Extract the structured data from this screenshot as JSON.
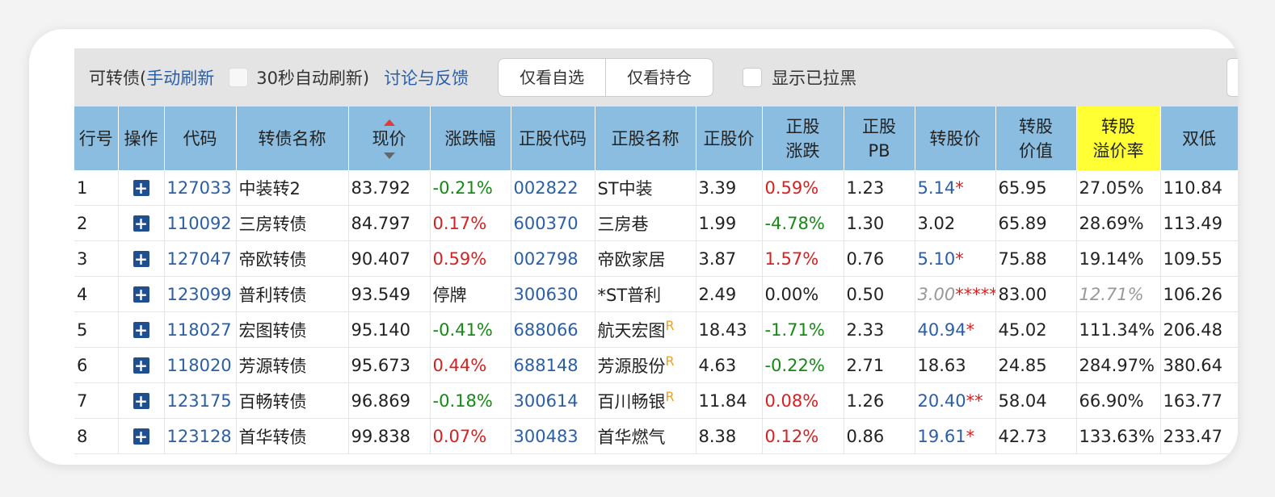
{
  "toolbar": {
    "prefix": "可转债(",
    "manual_refresh": "手动刷新",
    "auto_refresh": "30秒自动刷新)",
    "feedback": "讨论与反馈",
    "btn_watch": "仅看自选",
    "btn_hold": "仅看持仓",
    "show_blacklist": "显示已拉黑"
  },
  "columns": [
    "行号",
    "操作",
    "代码",
    "转债名称",
    "现价",
    "涨跌幅",
    "正股代码",
    "正股名称",
    "正股价",
    "正股涨跌",
    "正股PB",
    "转股价",
    "转股价值",
    "转股溢价率",
    "双低"
  ],
  "column_lines": {
    "stock_change": [
      "正股",
      "涨跌"
    ],
    "stock_pb": [
      "正股",
      "PB"
    ],
    "conv_value": [
      "转股",
      "价值"
    ],
    "premium": [
      "转股",
      "溢价率"
    ]
  },
  "rows": [
    {
      "no": "1",
      "code": "127033",
      "name": "中装转2",
      "price": "83.792",
      "chg": "-0.21%",
      "chg_dir": "down",
      "scode": "002822",
      "sname": "ST中装",
      "sR": "",
      "sprice": "3.39",
      "schg": "0.59%",
      "schg_dir": "up",
      "pb": "1.23",
      "cprice": "5.14",
      "cprice_star": "*",
      "cprice_style": "blue",
      "cval": "65.95",
      "prem": "27.05%",
      "prem_style": "",
      "dual": "110.84"
    },
    {
      "no": "2",
      "code": "110092",
      "name": "三房转债",
      "price": "84.797",
      "chg": "0.17%",
      "chg_dir": "up",
      "scode": "600370",
      "sname": "三房巷",
      "sR": "",
      "sprice": "1.99",
      "schg": "-4.78%",
      "schg_dir": "down",
      "pb": "1.30",
      "cprice": "3.02",
      "cprice_star": "",
      "cprice_style": "",
      "cval": "65.89",
      "prem": "28.69%",
      "prem_style": "",
      "dual": "113.49"
    },
    {
      "no": "3",
      "code": "127047",
      "name": "帝欧转债",
      "price": "90.407",
      "chg": "0.59%",
      "chg_dir": "up",
      "scode": "002798",
      "sname": "帝欧家居",
      "sR": "",
      "sprice": "3.87",
      "schg": "1.57%",
      "schg_dir": "up",
      "pb": "0.76",
      "cprice": "5.10",
      "cprice_star": "*",
      "cprice_style": "blue",
      "cval": "75.88",
      "prem": "19.14%",
      "prem_style": "",
      "dual": "109.55"
    },
    {
      "no": "4",
      "code": "123099",
      "name": "普利转债",
      "price": "93.549",
      "chg": "停牌",
      "chg_dir": "none",
      "scode": "300630",
      "sname": "*ST普利",
      "sR": "",
      "sprice": "2.49",
      "schg": "0.00%",
      "schg_dir": "none",
      "pb": "0.50",
      "cprice": "3.00",
      "cprice_star": "*****",
      "cprice_style": "gray",
      "cval": "83.00",
      "prem": "12.71%",
      "prem_style": "gray",
      "dual": "106.26"
    },
    {
      "no": "5",
      "code": "118027",
      "name": "宏图转债",
      "price": "95.140",
      "chg": "-0.41%",
      "chg_dir": "down",
      "scode": "688066",
      "sname": "航天宏图",
      "sR": "R",
      "sprice": "18.43",
      "schg": "-1.71%",
      "schg_dir": "down",
      "pb": "2.33",
      "cprice": "40.94",
      "cprice_star": "*",
      "cprice_style": "blue",
      "cval": "45.02",
      "prem": "111.34%",
      "prem_style": "",
      "dual": "206.48"
    },
    {
      "no": "6",
      "code": "118020",
      "name": "芳源转债",
      "price": "95.673",
      "chg": "0.44%",
      "chg_dir": "up",
      "scode": "688148",
      "sname": "芳源股份",
      "sR": "R",
      "sprice": "4.63",
      "schg": "-0.22%",
      "schg_dir": "down",
      "pb": "2.71",
      "cprice": "18.63",
      "cprice_star": "",
      "cprice_style": "",
      "cval": "24.85",
      "prem": "284.97%",
      "prem_style": "",
      "dual": "380.64"
    },
    {
      "no": "7",
      "code": "123175",
      "name": "百畅转债",
      "price": "96.869",
      "chg": "-0.18%",
      "chg_dir": "down",
      "scode": "300614",
      "sname": "百川畅银",
      "sR": "R",
      "sprice": "11.84",
      "schg": "0.08%",
      "schg_dir": "up",
      "pb": "1.26",
      "cprice": "20.40",
      "cprice_star": "**",
      "cprice_style": "blue",
      "cval": "58.04",
      "prem": "66.90%",
      "prem_style": "",
      "dual": "163.77"
    },
    {
      "no": "8",
      "code": "123128",
      "name": "首华转债",
      "price": "99.838",
      "chg": "0.07%",
      "chg_dir": "up",
      "scode": "300483",
      "sname": "首华燃气",
      "sR": "",
      "sprice": "8.38",
      "schg": "0.12%",
      "schg_dir": "up",
      "pb": "0.86",
      "cprice": "19.61",
      "cprice_star": "*",
      "cprice_style": "blue",
      "cval": "42.73",
      "prem": "133.63%",
      "prem_style": "",
      "dual": "233.47"
    }
  ],
  "plus_glyph": "+",
  "colors": {
    "header": "#8bbde0",
    "highlight": "#ffff33",
    "up": "#d92020",
    "down": "#148a14",
    "link": "#2a5fa8"
  }
}
